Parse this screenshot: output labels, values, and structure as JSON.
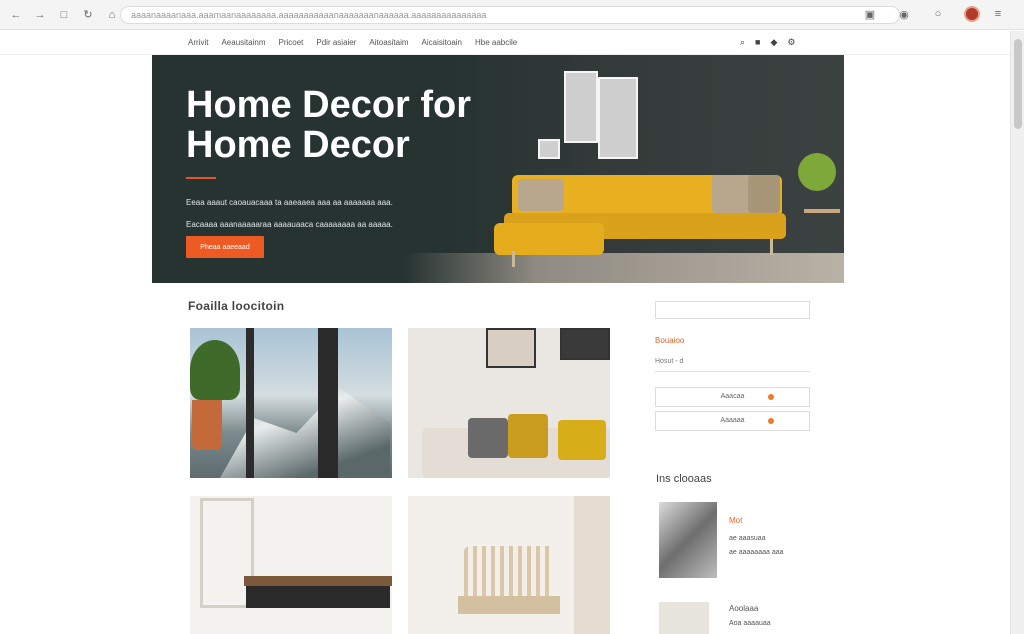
{
  "browser": {
    "url": "aaaanaaaanaaa.aaamaanaaaaaaaa.aaaaaaaaaaanaaaaaaanaaaaaa.aaaaaaaaaaaaaaa"
  },
  "nav": {
    "links": [
      "Arrivit",
      "Aeausitainm",
      "Pricoet",
      "Pdir asiaier",
      "Aitoasitaim",
      "Aicaisitoain",
      "Hbe aabcile"
    ]
  },
  "hero": {
    "title": "Home Decor for Home Decor",
    "description": "Eeaa aaaut caoauacaaa ta aaeaaea aaa aa aaaaaaa aaa. Eacaaaa aaanaaaaaraa aaaauaaca caaaaaaaa aa aaaaa.",
    "button_label": "Pheaa aaeeaad"
  },
  "section": {
    "title": "Foailla loocitoin"
  },
  "sidebar": {
    "search_placeholder": "",
    "title": "Bouaioo",
    "line_label": "Hosut - d",
    "buttons": [
      "Aaacaa",
      "Aaaaaa"
    ],
    "recent_heading": "Ins clooaas",
    "recent_items": [
      {
        "tag": "Mot",
        "text": "ae aaasuaa\nae aaaaaaaa aaa"
      },
      {
        "tag": "Aoolaaa",
        "text": "Aoa aaaauaa"
      }
    ]
  },
  "colors": {
    "hero_bg": "#263331",
    "accent": "#ee5a24",
    "sofa": "#e8b020"
  }
}
